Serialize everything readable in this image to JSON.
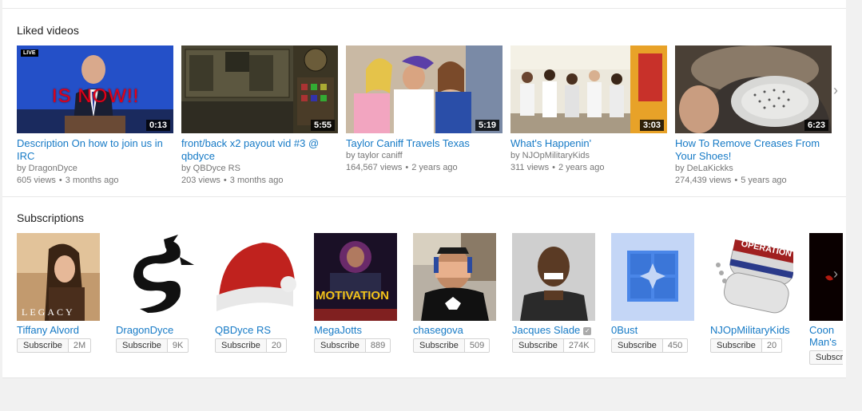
{
  "liked": {
    "title": "Liked videos",
    "videos": [
      {
        "title": "Description On how to join us in IRC",
        "by": "by DragonDyce",
        "views": "605 views",
        "age": "3 months ago",
        "duration": "0:13",
        "overlay": "IS NOW!!",
        "live": "LIVE"
      },
      {
        "title": "front/back x2 payout vid #3 @ qbdyce",
        "by": "by QBDyce RS",
        "views": "203 views",
        "age": "3 months ago",
        "duration": "5:55"
      },
      {
        "title": "Taylor Caniff Travels Texas",
        "by": "by taylor caniff",
        "views": "164,567 views",
        "age": "2 years ago",
        "duration": "5:19"
      },
      {
        "title": "What's Happenin'",
        "by": "by NJOpMilitaryKids",
        "views": "311 views",
        "age": "2 years ago",
        "duration": "3:03"
      },
      {
        "title": "How To Remove Creases From Your Shoes!",
        "by": "by DeLaKickks",
        "views": "274,439 views",
        "age": "5 years ago",
        "duration": "6:23"
      }
    ]
  },
  "subscriptions": {
    "title": "Subscriptions",
    "subscribe_label": "Subscribe",
    "channels": [
      {
        "name": "Tiffany Alvord",
        "count": "2M",
        "art": "LEGACY"
      },
      {
        "name": "DragonDyce",
        "count": "9K"
      },
      {
        "name": "QBDyce RS",
        "count": "20"
      },
      {
        "name": "MegaJotts",
        "count": "889",
        "art": "MOTIVATION"
      },
      {
        "name": "chasegova",
        "count": "509"
      },
      {
        "name": "Jacques Slade",
        "count": "274K",
        "verified": "✓"
      },
      {
        "name": "0Bust",
        "count": "450"
      },
      {
        "name": "NJOpMilitaryKids",
        "count": "20",
        "art": "OPERATION"
      },
      {
        "name": "Coon Man's",
        "count": ""
      }
    ]
  },
  "colors": {
    "link": "#167ac6",
    "meta": "#767676",
    "background": "#f1f1f1"
  }
}
